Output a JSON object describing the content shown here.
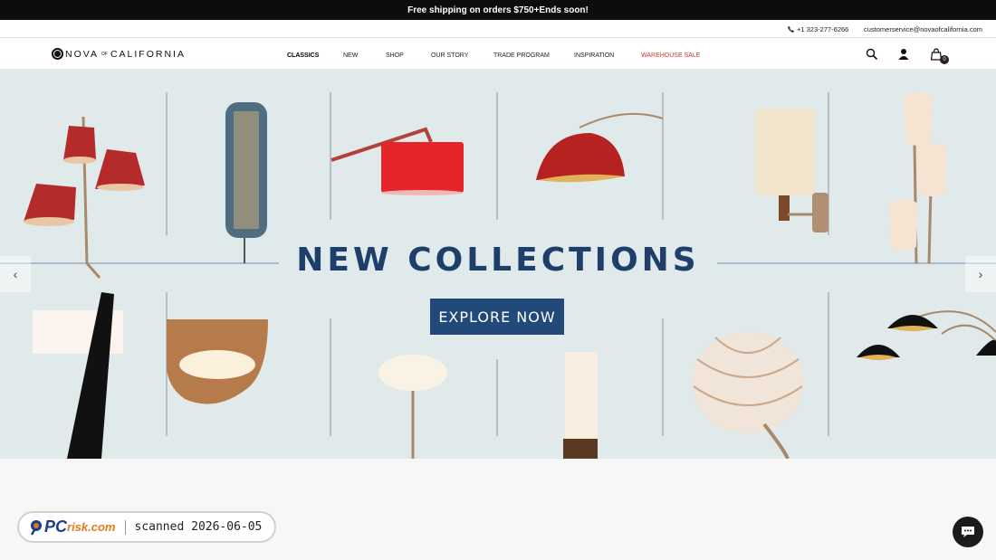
{
  "announcement": "Free shipping on orders $750+Ends soon!",
  "topbar": {
    "phone": "+1 323-277-6266",
    "email": "customerservice@novaofcalifornia.com"
  },
  "brand": {
    "left": "NOVA",
    "of": "OF",
    "right": "CALIFORNIA"
  },
  "nav": {
    "classics": "CLASSICS",
    "new": "NEW",
    "shop": "SHOP",
    "our_story": "OUR STORY",
    "trade_program": "TRADE PROGRAM",
    "inspiration": "INSPIRATION",
    "warehouse_sale": "WAREHOUSE SALE"
  },
  "cart_count": "0",
  "hero": {
    "title": "NEW COLLECTIONS",
    "cta": "EXPLORE NOW",
    "prev": "‹",
    "next": "›"
  },
  "watermark": {
    "brand_pc": "PC",
    "brand_risk": "risk.com",
    "scanned": "scanned 2026-06-05"
  },
  "icons": {
    "search": "search-icon",
    "account": "user-icon",
    "cart": "cart-icon",
    "chat": "chat-icon",
    "phone": "phone-icon"
  },
  "colors": {
    "accent": "#214a7a",
    "sale": "#c0392b",
    "hero_bg": "#e0eaea"
  }
}
